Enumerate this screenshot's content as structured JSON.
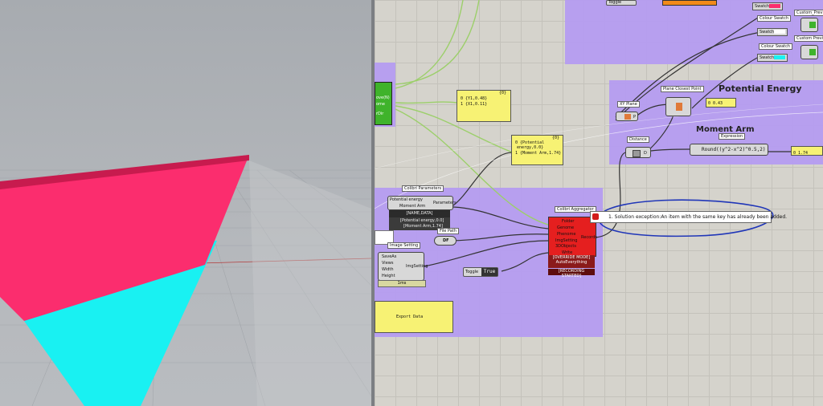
{
  "canvas": {
    "groups": {
      "potential_energy_title": "Potential Energy",
      "moment_arm_title": "Moment Arm"
    },
    "panels": {
      "panel_top_line1": "0 {Y1,0.48}",
      "panel_top_line2": "1 {X1,0.11}",
      "panel_mid_line1": "0 {Potential",
      "panel_mid_line2": "energy,0.0}",
      "panel_mid_line3": "1 {Moment Arm,1.74}",
      "panel_right_value": "0 1.74",
      "panel_small_value": "0 0.43",
      "export_label": "Export Data",
      "panel_hdr": "{0}"
    },
    "colibri_params": {
      "title": "Colibri Parameters",
      "input1": "Potential energy",
      "input2": "Moment Arm",
      "output": "Parameters",
      "header_bar": "[NAME,DATA]",
      "data_line1": "[Potential energy,0.0]",
      "data_line2": "[Moment Arm,1.74]"
    },
    "fly_path": {
      "label": "File Path",
      "glyph": "DF"
    },
    "image_setting": {
      "title": "Image Setting",
      "inputs": [
        "SaveAs",
        "Views",
        "Width",
        "Height"
      ],
      "output": "ImgSetting",
      "footer": "1ms"
    },
    "aggregator": {
      "title": "Colibri Aggregator",
      "inputs": [
        "Folder",
        "Genome",
        "Phenome",
        "ImgSetting",
        "3DObjects",
        "Write"
      ],
      "output": "Records",
      "override": "[OVERRIDE MODE]",
      "override_sub": "AutoEverything",
      "recording": "[RECORDING STARTED]"
    },
    "error": {
      "message": "1. Solution exception:An item with the same key has already been added."
    },
    "toggle": {
      "label": "Toggle",
      "value": "True"
    },
    "xy_plane": {
      "label": "XY Plane",
      "ports": "P"
    },
    "plane_closest": {
      "label": "Plane Closest Point"
    },
    "distance": {
      "label": "Distance",
      "ports": "D"
    },
    "expression": {
      "label": "Expression",
      "formula": "Round((y^2-x^2)^0.5,2)"
    },
    "top_right": {
      "toggle_label": "Toggle",
      "colour_swatch1": "Colour Swatch",
      "colour_swatch2": "Colour Swatch",
      "swatch": "Swatch",
      "custom_preview1": "Custom_Preview",
      "custom_preview2": "Custom Preview",
      "small_label": "Swatch"
    },
    "left_partial": {
      "line1": "ove(N)",
      "line2": "ome",
      "line3": "rDir"
    }
  },
  "colors": {
    "group_purple": "#b59cf0",
    "panel_yellow": "#f7f274",
    "error_red": "#e51f1f",
    "wire_green": "#9ccf6a",
    "wire_dark": "#333333",
    "viewport_pink": "#fb2d6e",
    "viewport_cyan": "#19f1f2"
  }
}
